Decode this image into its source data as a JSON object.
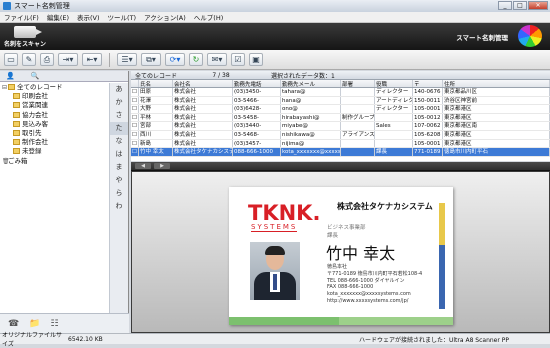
{
  "window": {
    "title": "スマート名刺管理",
    "min": "_",
    "max": "□",
    "close": "✕"
  },
  "menu": [
    "ファイル(F)",
    "編集(E)",
    "表示(V)",
    "ツール(T)",
    "アクション(A)",
    "ヘルプ(H)"
  ],
  "banner": {
    "scan_label": "名刺をスキャン",
    "brand": "スマート名刺管理"
  },
  "toolbar": {
    "icons": [
      "new-card-icon",
      "edit-icon",
      "print-icon",
      "export-icon",
      "import-icon",
      "sort-icon",
      "copy-icon",
      "sync-icon",
      "refresh-icon",
      "mail-icon",
      "select-icon",
      "window-icon"
    ]
  },
  "left": {
    "tree": [
      {
        "label": "全てのレコード",
        "level": 0
      },
      {
        "label": "印刷会社",
        "level": 1
      },
      {
        "label": "営業関連",
        "level": 1
      },
      {
        "label": "協力会社",
        "level": 1
      },
      {
        "label": "見込み客",
        "level": 1
      },
      {
        "label": "取引先",
        "level": 1
      },
      {
        "label": "制作会社",
        "level": 1
      },
      {
        "label": "未登録",
        "level": 1
      },
      {
        "label": "ごみ箱",
        "level": 0
      }
    ],
    "index": [
      "あ",
      "か",
      "さ",
      "た",
      "な",
      "は",
      "ま",
      "や",
      "ら",
      "わ"
    ]
  },
  "grid": {
    "folder": "全てのレコード",
    "count": "7 / 38",
    "selected_label": "選択されたデータ数：1",
    "columns": [
      "",
      "氏名",
      "会社名",
      "勤務先電話",
      "勤務先メール",
      "部署",
      "役職",
      "〒",
      "住所"
    ],
    "rows": [
      [
        "",
        "田原",
        "株式会社",
        "(03)3450-",
        "tahara@",
        "",
        "ディレクター",
        "140-0676",
        "東京都品川区"
      ],
      [
        "",
        "花澤",
        "株式会社",
        "03-5466-",
        "hana@",
        "",
        "アートディレクター",
        "150-0011",
        "渋谷区神宮前"
      ],
      [
        "",
        "大野",
        "株式会社",
        "(03)6428-",
        "ono@",
        "",
        "ディレクター",
        "105-0001",
        "東京都港区"
      ],
      [
        "",
        "平林",
        "株式会社",
        "03-5458-",
        "hirabayashi@",
        "制作グループ",
        "",
        "105-0012",
        "東京都港区"
      ],
      [
        "",
        "宮部",
        "株式会社",
        "(03)3440-",
        "miyabe@",
        "",
        "Sales",
        "107-0062",
        "東京都港区南"
      ],
      [
        "",
        "西川",
        "株式会社",
        "03-5468-",
        "nishikawa@",
        "アライアンス",
        "",
        "105-6208",
        "東京都港区"
      ],
      [
        "",
        "新島",
        "株式会社",
        "(03)3457-",
        "nijima@",
        "",
        "",
        "105-0001",
        "東京都港区"
      ],
      [
        "",
        "竹中 幸太",
        "株式会社タケナカシステム",
        "088-666-1000",
        "kota_xxxxxxx@xxxxsystems",
        "",
        "課長",
        "771-0189",
        "徳島市川内町平石"
      ]
    ],
    "selected_row": 7
  },
  "card": {
    "logo_main": "TKNK.",
    "logo_sub": "SYSTEMS",
    "company": "株式会社タケナカシステム",
    "department": "ビジネス事業部",
    "position": "課長",
    "name": "竹中 幸太",
    "office": "徳島本社",
    "postal": "〒771-0189 徳島市川内町平石若松108-4",
    "tel": "TEL 088-666-1000 ダイヤルイン",
    "fax": "FAX 088-666-1000",
    "email": "kota_xxxxxxx@xxxxsystems.com",
    "web": "http://www.xxxxsystems.com/jp/"
  },
  "status": {
    "size_label": "オリジナルファイルサイズ",
    "size_value": "6542.10 KB",
    "scanner": "ハードウェアが接続されました：Ultra A8 Scanner PP"
  }
}
